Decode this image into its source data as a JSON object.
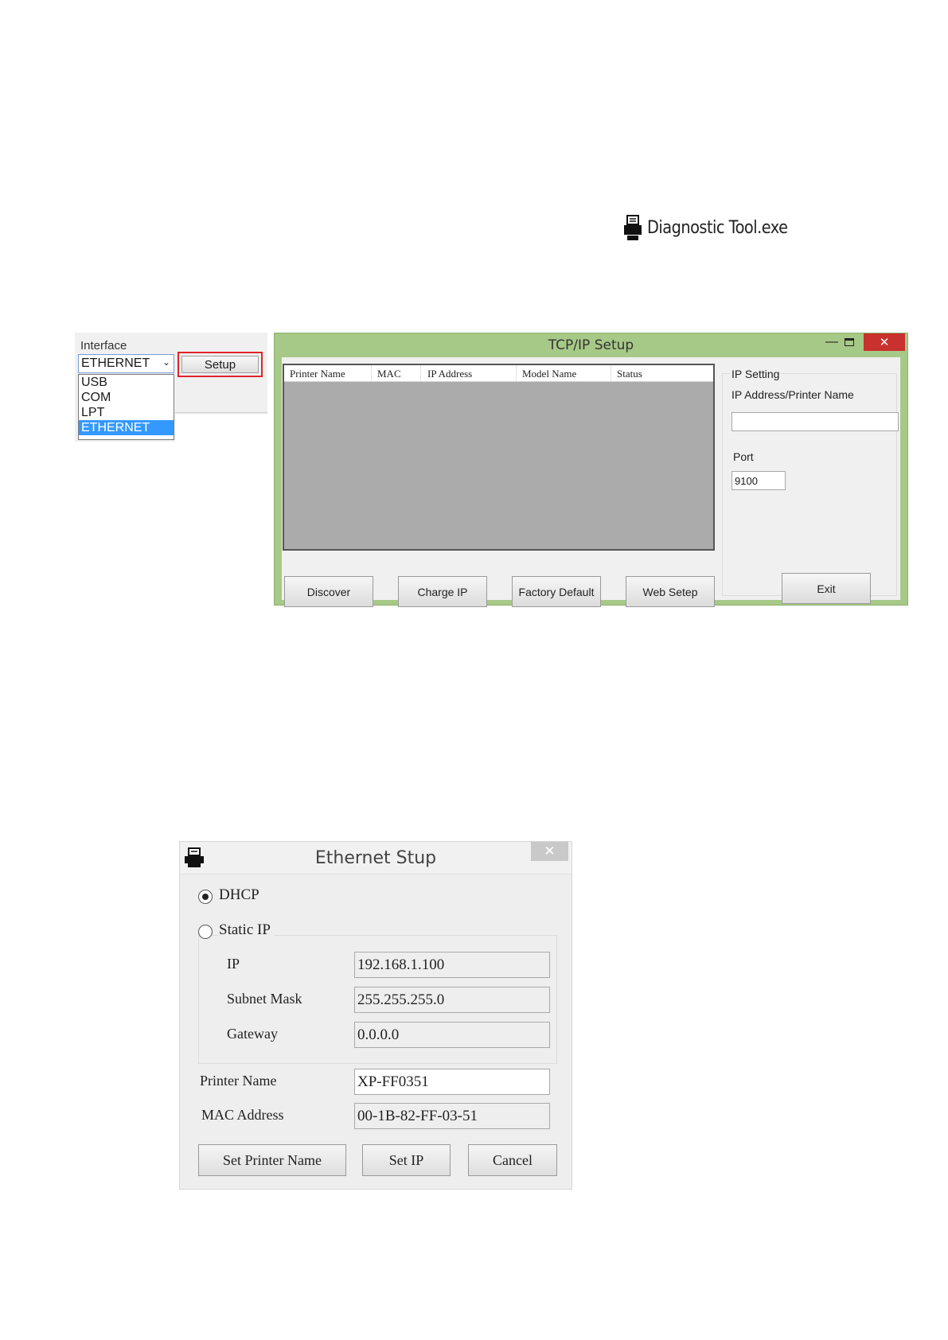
{
  "diagnostic_file": {
    "icon": "printer-icon",
    "label": "Diagnostic Tool.exe"
  },
  "interface_panel": {
    "title": "Interface",
    "selected": "ETHERNET",
    "setup_label": "Setup",
    "options": [
      "USB",
      "COM",
      "LPT",
      "ETHERNET"
    ],
    "highlight_color": "#e0242b"
  },
  "tcp_window": {
    "title": "TCP/IP Setup",
    "close_glyph": "✕",
    "columns": [
      "Printer Name",
      "MAC",
      "IP Address",
      "Model Name",
      "Status"
    ],
    "buttons": [
      "Discover",
      "Charge IP",
      "Factory Default",
      "Web Setep"
    ],
    "ip_setting": {
      "group_label": "IP Setting",
      "address_label": "IP Address/Printer Name",
      "address_value": "",
      "port_label": "Port",
      "port_value": "9100"
    },
    "exit_label": "Exit",
    "frame_color": "#a7c987"
  },
  "ethernet_dialog": {
    "title": "Ethernet Stup",
    "close_glyph": "✕",
    "dhcp_label": "DHCP",
    "static_label": "Static IP",
    "mode": "DHCP",
    "ip_label": "IP",
    "ip_value": "192.168.1.100",
    "mask_label": "Subnet Mask",
    "mask_value": "255.255.255.0",
    "gateway_label": "Gateway",
    "gateway_value": "0.0.0.0",
    "printer_name_label": "Printer Name",
    "printer_name_value": "XP-FF0351",
    "mac_label": "MAC Address",
    "mac_value": "00-1B-82-FF-03-51",
    "set_printer_name_label": "Set Printer Name",
    "set_ip_label": "Set IP",
    "cancel_label": "Cancel"
  }
}
